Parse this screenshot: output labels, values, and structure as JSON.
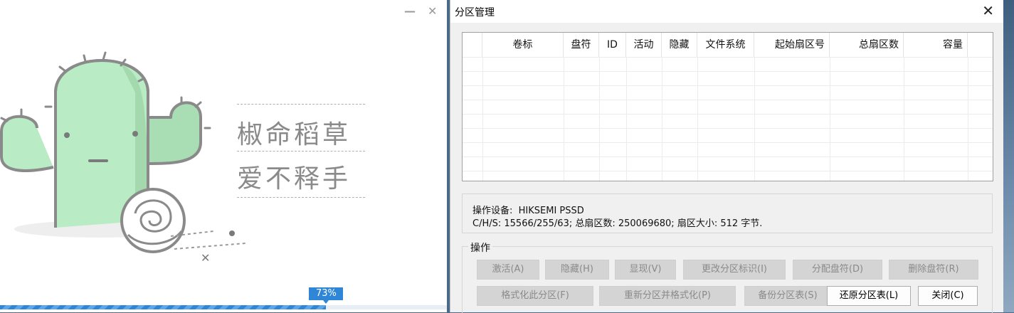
{
  "promo": {
    "slogan_line1": "椒命稻草",
    "slogan_line2": "爱不释手",
    "progress_label": "73%",
    "progress_value": 0.73
  },
  "dialog": {
    "title": "分区管理",
    "table": {
      "columns": [
        "卷标",
        "盘符",
        "ID",
        "活动",
        "隐藏",
        "文件系统",
        "起始扇区号",
        "总扇区数",
        "容量"
      ]
    },
    "info": {
      "line1": "操作设备:  HIKSEMI PSSD",
      "line2": "C/H/S: 15566/255/63; 总扇区数: 250069680; 扇区大小: 512 字节."
    },
    "ops": {
      "group_title": "操作",
      "buttons": [
        {
          "label": "激活(A)",
          "enabled": false
        },
        {
          "label": "隐藏(H)",
          "enabled": false
        },
        {
          "label": "显现(V)",
          "enabled": false
        },
        {
          "label": "更改分区标识(I)",
          "enabled": false
        },
        {
          "label": "分配盘符(D)",
          "enabled": false
        },
        {
          "label": "删除盘符(R)",
          "enabled": false
        },
        {
          "label": "格式化此分区(F)",
          "enabled": false
        },
        {
          "label": "重新分区并格式化(P)",
          "enabled": false
        },
        {
          "label": "备份分区表(S)",
          "enabled": false
        },
        {
          "label": "还原分区表(L)",
          "enabled": true
        },
        {
          "label": "关闭(C)",
          "enabled": true
        }
      ]
    }
  },
  "colors": {
    "accent": "#2f86d6",
    "cactus_green": "#b9ecc4",
    "cactus_outline": "#8a8a8a"
  }
}
